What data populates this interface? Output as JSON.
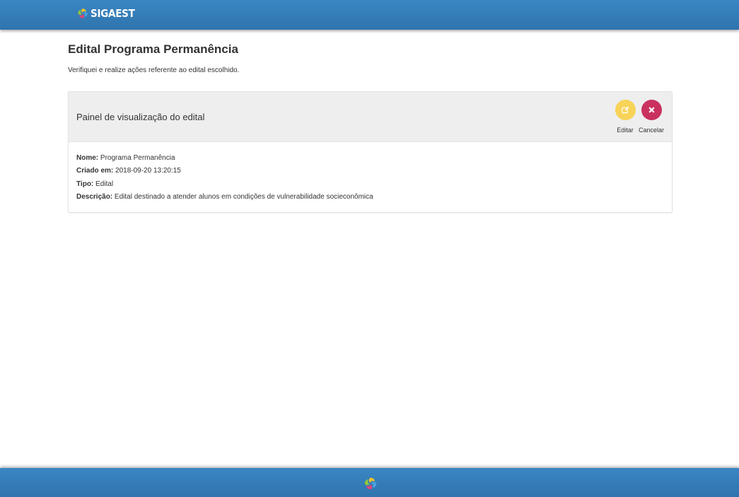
{
  "header": {
    "brand": "SIGAEST"
  },
  "page": {
    "title": "Edital Programa Permanência",
    "subtitle": "Verifiquei e realize ações referente ao edital escolhido."
  },
  "panel": {
    "title": "Painel de visualização do edital",
    "actions": {
      "edit_label": "Editar",
      "cancel_label": "Cancelar"
    },
    "fields": [
      {
        "label": "Nome:",
        "value": "Programa Permanência"
      },
      {
        "label": "Criado em:",
        "value": "2018-09-20 13:20:15"
      },
      {
        "label": "Tipo:",
        "value": "Edital"
      },
      {
        "label": "Descrição:",
        "value": "Edital destinado a atender alunos em condições de vulnerabilidade socieconômica"
      }
    ]
  },
  "colors": {
    "header_blue": "#2f74ad",
    "edit_yellow": "#f7d358",
    "cancel_red": "#c9325f"
  },
  "icons": {
    "logo": "sigaest-swirl-logo",
    "edit": "edit-icon",
    "cancel": "close-icon"
  }
}
